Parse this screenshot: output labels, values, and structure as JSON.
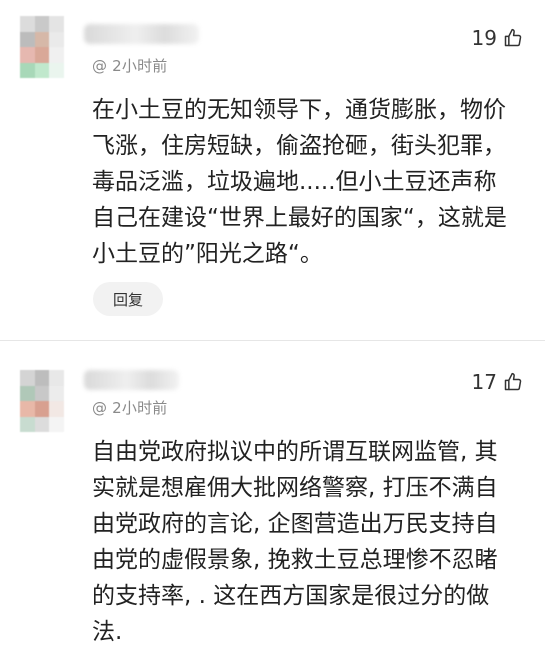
{
  "comments": [
    {
      "timestamp": "@ 2小时前",
      "likes": "19",
      "text": "在小土豆的无知领导下，通货膨胀，物价\n飞涨，住房短缺，偷盗抢砸，街头犯罪，\n毒品泛滥，垃圾遍地.....但小土豆还声称\n自己在建设“世界上最好的国家“，这就是\n小土豆的”阳光之路“。",
      "reply_label": "回复",
      "avatar_colors": [
        "#dcdcdc",
        "#c9c9c9",
        "#e4e4e4",
        "#bcbcbc",
        "#d6b8a8",
        "#eaeaea",
        "#e6b8b0",
        "#d9a898",
        "#f0f0f0",
        "#a8d8b8",
        "#c0e8cc",
        "#eaf5ee"
      ]
    },
    {
      "timestamp": "@ 2小时前",
      "likes": "17",
      "text": "自由党政府拟议中的所谓互联网监管, 其\n实就是想雇佣大批网络警察, 打压不满自\n由党政府的言论, 企图营造出万民支持自\n由党的虚假景象, 挽救土豆总理惨不忍睹\n的支持率, . 这在西方国家是很过分的做\n法.",
      "avatar_colors": [
        "#d4d4d4",
        "#bdbdbd",
        "#e8e8e8",
        "#b0c8b8",
        "#c8c8c8",
        "#ececec",
        "#e8b8a8",
        "#d8a090",
        "#f2e8e4",
        "#c8dcd0",
        "#dcdcdc",
        "#f4f4f4"
      ]
    }
  ],
  "icons": {
    "like": "thumbs-up-icon"
  }
}
